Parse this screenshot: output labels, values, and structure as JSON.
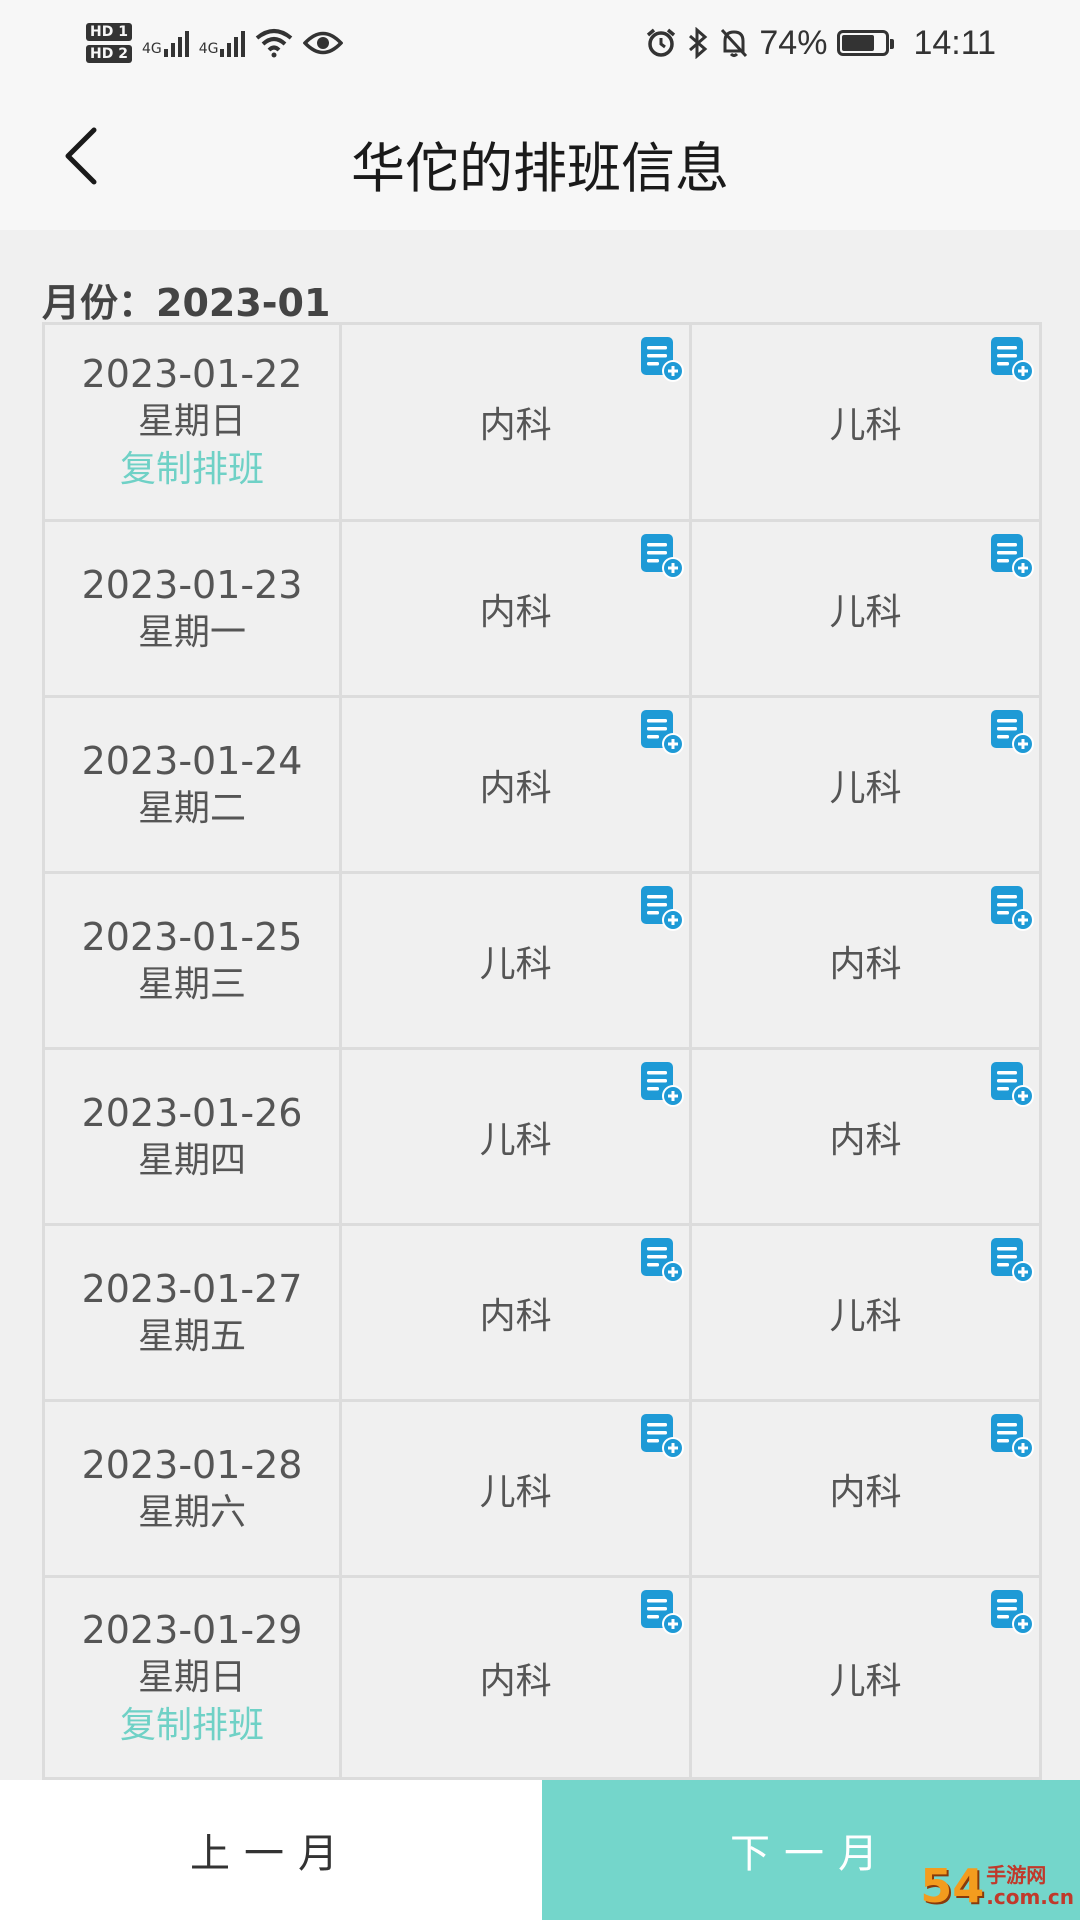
{
  "status_bar": {
    "hd1": "HD 1",
    "hd2": "HD 2",
    "net1": "4G",
    "net2": "4G",
    "battery_pct": "74%",
    "battery_level": 0.74,
    "time": "14:11",
    "icons": [
      "alarm-icon",
      "bluetooth-icon",
      "mute-icon",
      "eye-icon",
      "wifi-icon"
    ]
  },
  "header": {
    "title": "华佗的排班信息"
  },
  "month": {
    "label": "月份：",
    "value": "2023-01"
  },
  "rows": [
    {
      "date": "2023-01-22",
      "weekday": "星期日",
      "copy": "复制排班",
      "shift1": "内科",
      "shift2": "儿科"
    },
    {
      "date": "2023-01-23",
      "weekday": "星期一",
      "copy": "",
      "shift1": "内科",
      "shift2": "儿科"
    },
    {
      "date": "2023-01-24",
      "weekday": "星期二",
      "copy": "",
      "shift1": "内科",
      "shift2": "儿科"
    },
    {
      "date": "2023-01-25",
      "weekday": "星期三",
      "copy": "",
      "shift1": "儿科",
      "shift2": "内科"
    },
    {
      "date": "2023-01-26",
      "weekday": "星期四",
      "copy": "",
      "shift1": "儿科",
      "shift2": "内科"
    },
    {
      "date": "2023-01-27",
      "weekday": "星期五",
      "copy": "",
      "shift1": "内科",
      "shift2": "儿科"
    },
    {
      "date": "2023-01-28",
      "weekday": "星期六",
      "copy": "",
      "shift1": "儿科",
      "shift2": "内科"
    },
    {
      "date": "2023-01-29",
      "weekday": "星期日",
      "copy": "复制排班",
      "shift1": "内科",
      "shift2": "儿科"
    }
  ],
  "footer": {
    "prev": "上一月",
    "next": "下一月"
  },
  "watermark": {
    "num": "54",
    "brand": "手游网",
    "domain": ".com.cn"
  },
  "colors": {
    "accent": "#74d6cb",
    "link": "#6fd1c6",
    "icon_blue": "#1e9ad6"
  }
}
